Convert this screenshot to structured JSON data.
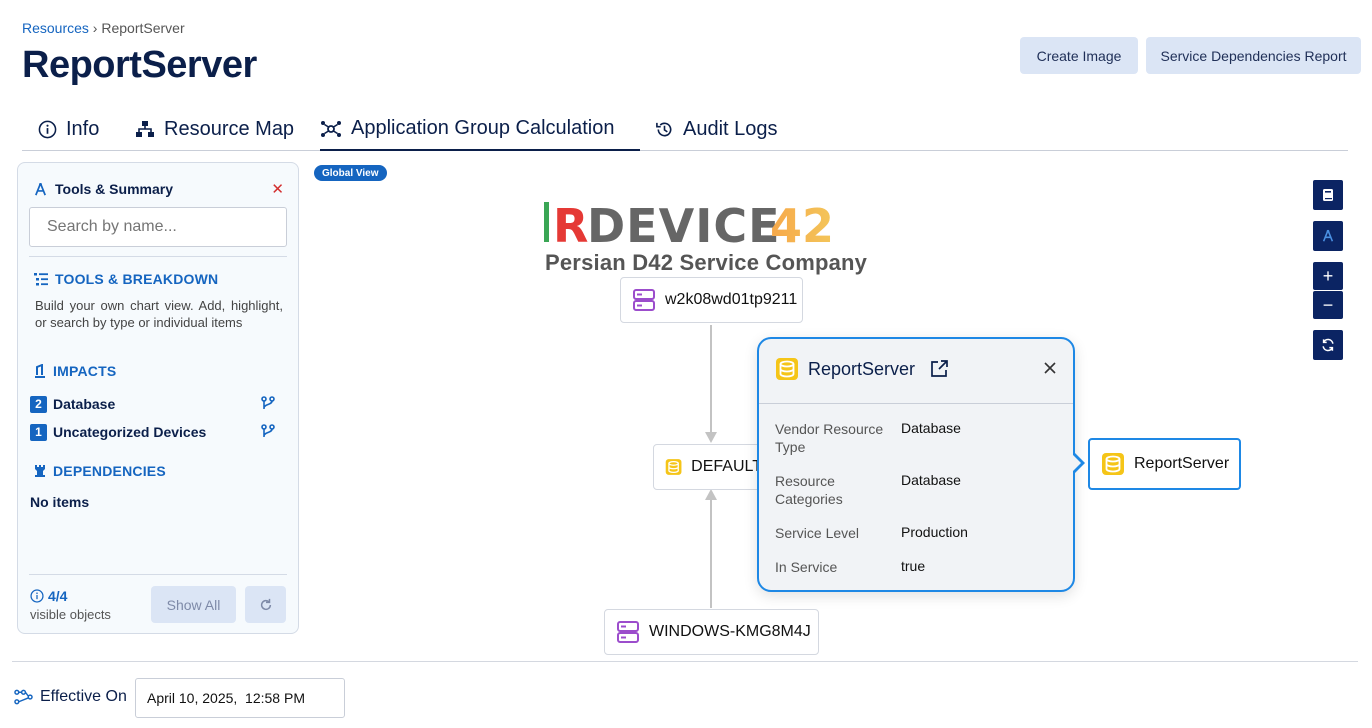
{
  "breadcrumb": {
    "root": "Resources",
    "separator": " › ",
    "current": "ReportServer"
  },
  "page": {
    "title": "ReportServer"
  },
  "header_buttons": {
    "create_image": "Create Image",
    "dependencies_report": "Service Dependencies Report"
  },
  "tabs": [
    {
      "label": "Info",
      "icon": "info-circle-icon",
      "active": false
    },
    {
      "label": "Resource Map",
      "icon": "hierarchy-icon",
      "active": false
    },
    {
      "label": "Application Group Calculation",
      "icon": "graph-nodes-icon",
      "active": true
    },
    {
      "label": "Audit Logs",
      "icon": "history-icon",
      "active": false
    }
  ],
  "panel": {
    "title": "Tools & Summary",
    "search_placeholder": "Search by name...",
    "tools_title": "TOOLS & BREAKDOWN",
    "tools_description": "Build your own chart view. Add, highlight, or search by type or individual items",
    "impacts_title": "IMPACTS",
    "impacts": [
      {
        "count": "2",
        "label": "Database"
      },
      {
        "count": "1",
        "label": "Uncategorized Devices"
      }
    ],
    "dependencies_title": "DEPENDENCIES",
    "dependencies_empty": "No items",
    "visible_count": "4/4",
    "visible_label": "visible objects",
    "show_all": "Show All"
  },
  "canvas": {
    "global_view_badge": "Global View",
    "watermark_logo": "IRDEVICE42",
    "watermark_sub": "Persian D42 Service Company",
    "nodes": {
      "top": "w2k08wd01tp9211",
      "middle": "DEFAULT",
      "bottom": "WINDOWS-KMG8M4J",
      "selected": "ReportServer"
    }
  },
  "popup": {
    "title": "ReportServer",
    "rows": [
      {
        "key": "Vendor Resource Type",
        "value": "Database"
      },
      {
        "key": "Resource Categories",
        "value": "Database"
      },
      {
        "key": "Service Level",
        "value": "Production"
      },
      {
        "key": "In Service",
        "value": "true"
      }
    ]
  },
  "controls": {
    "zoom_in": "+",
    "zoom_out": "−"
  },
  "effective_on": {
    "label": "Effective On",
    "value": "April 10, 2025,  12:58 PM"
  },
  "colors": {
    "brand_navy": "#0b1f4a",
    "accent_blue": "#1565c0",
    "button_light": "#dbe5f5",
    "db_yellow": "#f5c518",
    "server_purple": "#9c4dcc"
  }
}
